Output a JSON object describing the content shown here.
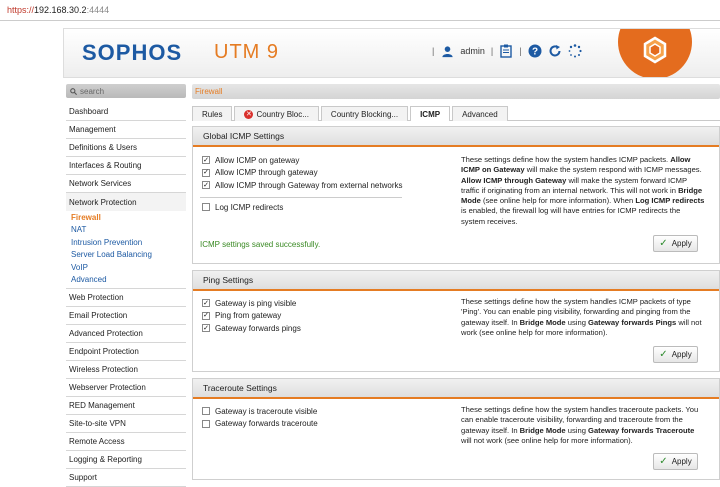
{
  "address": {
    "scheme": "https://",
    "host": "192.168.30.2",
    "port": ":4444"
  },
  "header": {
    "brand": "SOPHOS",
    "product": "UTM 9",
    "user": "admin",
    "icons": [
      "user-icon",
      "clipboard-icon",
      "help-icon",
      "reload-icon",
      "spinner-icon"
    ]
  },
  "sidebar": {
    "search_placeholder": "search",
    "items": [
      {
        "label": "Dashboard"
      },
      {
        "label": "Management"
      },
      {
        "label": "Definitions & Users"
      },
      {
        "label": "Interfaces & Routing"
      },
      {
        "label": "Network Services"
      },
      {
        "label": "Network Protection"
      },
      {
        "label": "Web Protection"
      },
      {
        "label": "Email Protection"
      },
      {
        "label": "Advanced Protection"
      },
      {
        "label": "Endpoint Protection"
      },
      {
        "label": "Wireless Protection"
      },
      {
        "label": "Webserver Protection"
      },
      {
        "label": "RED Management"
      },
      {
        "label": "Site-to-site VPN"
      },
      {
        "label": "Remote Access"
      },
      {
        "label": "Logging & Reporting"
      },
      {
        "label": "Support"
      }
    ],
    "sub_items": [
      "Firewall",
      "NAT",
      "Intrusion Prevention",
      "Server Load Balancing",
      "VoIP",
      "Advanced"
    ]
  },
  "main": {
    "breadcrumb": "Firewall",
    "tabs": [
      "Rules",
      "Country Bloc...",
      "Country Blocking...",
      "ICMP",
      "Advanced"
    ],
    "active_tab": "ICMP",
    "apply_label": "Apply",
    "global": {
      "title": "Global ICMP Settings",
      "options": [
        {
          "label": "Allow ICMP on gateway",
          "checked": true
        },
        {
          "label": "Allow ICMP through gateway",
          "checked": true
        },
        {
          "label": "Allow ICMP through Gateway from external networks",
          "checked": true
        },
        {
          "label": "Log ICMP redirects",
          "checked": false
        }
      ],
      "message": "ICMP settings saved successfully."
    },
    "ping": {
      "title": "Ping Settings",
      "options": [
        {
          "label": "Gateway is ping visible",
          "checked": true
        },
        {
          "label": "Ping from gateway",
          "checked": true
        },
        {
          "label": "Gateway forwards pings",
          "checked": true
        }
      ]
    },
    "traceroute": {
      "title": "Traceroute Settings",
      "options": [
        {
          "label": "Gateway is traceroute visible",
          "checked": false
        },
        {
          "label": "Gateway forwards traceroute",
          "checked": false
        }
      ]
    }
  },
  "colors": {
    "accent": "#e57c23",
    "brand": "#1d5aa3",
    "success": "#3a8a24"
  }
}
